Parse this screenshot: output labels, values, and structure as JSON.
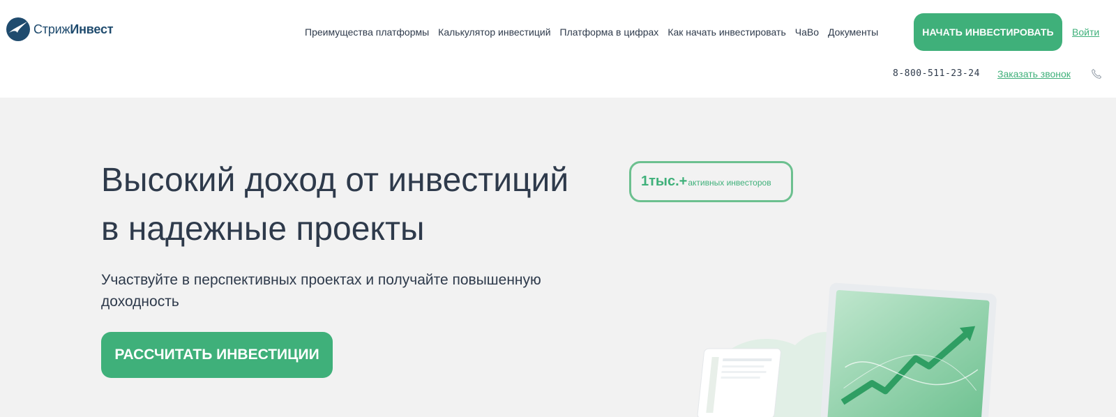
{
  "brand": {
    "name_light": "Стриж",
    "name_bold": "Инвест"
  },
  "nav": {
    "items": [
      "Преимущества платформы",
      "Калькулятор инвестиций",
      "Платформа в цифрах",
      "Как начать инвестировать",
      "ЧаВо",
      "Документы"
    ]
  },
  "header": {
    "cta_label": "НАЧАТЬ ИНВЕСТИРОВАТЬ",
    "login_label": "Войти",
    "phone": "8-800-511-23-24",
    "callback_label": "Заказать звонок"
  },
  "hero": {
    "title_line1": "Высокий доход от инвестиций",
    "title_line2": "в надежные проекты",
    "subtitle": "Участвуйте в перспективных проектах и получайте повышенную доходность",
    "cta_label": "РАССЧИТАТЬ ИНВЕСТИЦИИ",
    "badge_value": "1тыс.+",
    "badge_label": "активных инвесторов"
  },
  "colors": {
    "accent": "#3fb07a",
    "text": "#2e3a4b",
    "hero_bg": "#f2f2f2",
    "logo": "#1f4b6e"
  },
  "icons": [
    "logo-swift-icon",
    "phone-icon"
  ]
}
